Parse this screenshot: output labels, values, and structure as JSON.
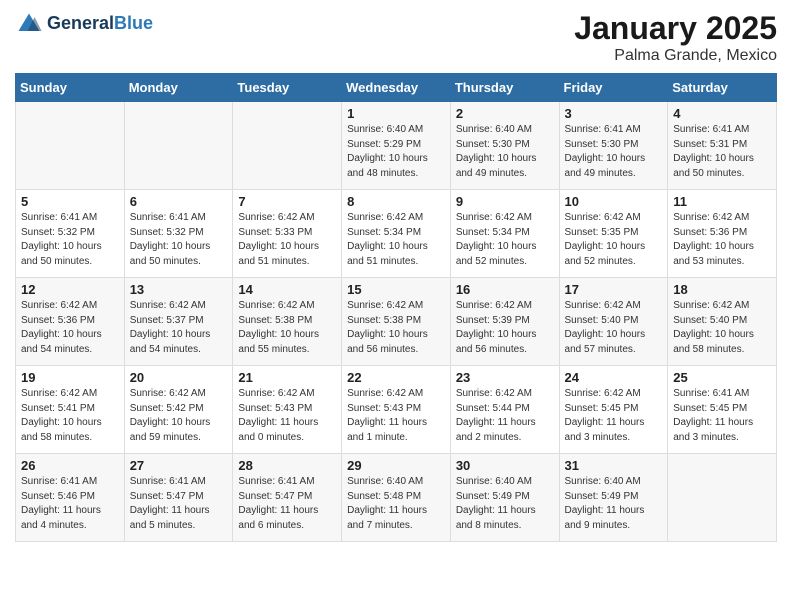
{
  "logo": {
    "line1": "General",
    "line2": "Blue"
  },
  "title": "January 2025",
  "subtitle": "Palma Grande, Mexico",
  "days_of_week": [
    "Sunday",
    "Monday",
    "Tuesday",
    "Wednesday",
    "Thursday",
    "Friday",
    "Saturday"
  ],
  "weeks": [
    [
      {
        "day": "",
        "info": ""
      },
      {
        "day": "",
        "info": ""
      },
      {
        "day": "",
        "info": ""
      },
      {
        "day": "1",
        "info": "Sunrise: 6:40 AM\nSunset: 5:29 PM\nDaylight: 10 hours\nand 48 minutes."
      },
      {
        "day": "2",
        "info": "Sunrise: 6:40 AM\nSunset: 5:30 PM\nDaylight: 10 hours\nand 49 minutes."
      },
      {
        "day": "3",
        "info": "Sunrise: 6:41 AM\nSunset: 5:30 PM\nDaylight: 10 hours\nand 49 minutes."
      },
      {
        "day": "4",
        "info": "Sunrise: 6:41 AM\nSunset: 5:31 PM\nDaylight: 10 hours\nand 50 minutes."
      }
    ],
    [
      {
        "day": "5",
        "info": "Sunrise: 6:41 AM\nSunset: 5:32 PM\nDaylight: 10 hours\nand 50 minutes."
      },
      {
        "day": "6",
        "info": "Sunrise: 6:41 AM\nSunset: 5:32 PM\nDaylight: 10 hours\nand 50 minutes."
      },
      {
        "day": "7",
        "info": "Sunrise: 6:42 AM\nSunset: 5:33 PM\nDaylight: 10 hours\nand 51 minutes."
      },
      {
        "day": "8",
        "info": "Sunrise: 6:42 AM\nSunset: 5:34 PM\nDaylight: 10 hours\nand 51 minutes."
      },
      {
        "day": "9",
        "info": "Sunrise: 6:42 AM\nSunset: 5:34 PM\nDaylight: 10 hours\nand 52 minutes."
      },
      {
        "day": "10",
        "info": "Sunrise: 6:42 AM\nSunset: 5:35 PM\nDaylight: 10 hours\nand 52 minutes."
      },
      {
        "day": "11",
        "info": "Sunrise: 6:42 AM\nSunset: 5:36 PM\nDaylight: 10 hours\nand 53 minutes."
      }
    ],
    [
      {
        "day": "12",
        "info": "Sunrise: 6:42 AM\nSunset: 5:36 PM\nDaylight: 10 hours\nand 54 minutes."
      },
      {
        "day": "13",
        "info": "Sunrise: 6:42 AM\nSunset: 5:37 PM\nDaylight: 10 hours\nand 54 minutes."
      },
      {
        "day": "14",
        "info": "Sunrise: 6:42 AM\nSunset: 5:38 PM\nDaylight: 10 hours\nand 55 minutes."
      },
      {
        "day": "15",
        "info": "Sunrise: 6:42 AM\nSunset: 5:38 PM\nDaylight: 10 hours\nand 56 minutes."
      },
      {
        "day": "16",
        "info": "Sunrise: 6:42 AM\nSunset: 5:39 PM\nDaylight: 10 hours\nand 56 minutes."
      },
      {
        "day": "17",
        "info": "Sunrise: 6:42 AM\nSunset: 5:40 PM\nDaylight: 10 hours\nand 57 minutes."
      },
      {
        "day": "18",
        "info": "Sunrise: 6:42 AM\nSunset: 5:40 PM\nDaylight: 10 hours\nand 58 minutes."
      }
    ],
    [
      {
        "day": "19",
        "info": "Sunrise: 6:42 AM\nSunset: 5:41 PM\nDaylight: 10 hours\nand 58 minutes."
      },
      {
        "day": "20",
        "info": "Sunrise: 6:42 AM\nSunset: 5:42 PM\nDaylight: 10 hours\nand 59 minutes."
      },
      {
        "day": "21",
        "info": "Sunrise: 6:42 AM\nSunset: 5:43 PM\nDaylight: 11 hours\nand 0 minutes."
      },
      {
        "day": "22",
        "info": "Sunrise: 6:42 AM\nSunset: 5:43 PM\nDaylight: 11 hours\nand 1 minute."
      },
      {
        "day": "23",
        "info": "Sunrise: 6:42 AM\nSunset: 5:44 PM\nDaylight: 11 hours\nand 2 minutes."
      },
      {
        "day": "24",
        "info": "Sunrise: 6:42 AM\nSunset: 5:45 PM\nDaylight: 11 hours\nand 3 minutes."
      },
      {
        "day": "25",
        "info": "Sunrise: 6:41 AM\nSunset: 5:45 PM\nDaylight: 11 hours\nand 3 minutes."
      }
    ],
    [
      {
        "day": "26",
        "info": "Sunrise: 6:41 AM\nSunset: 5:46 PM\nDaylight: 11 hours\nand 4 minutes."
      },
      {
        "day": "27",
        "info": "Sunrise: 6:41 AM\nSunset: 5:47 PM\nDaylight: 11 hours\nand 5 minutes."
      },
      {
        "day": "28",
        "info": "Sunrise: 6:41 AM\nSunset: 5:47 PM\nDaylight: 11 hours\nand 6 minutes."
      },
      {
        "day": "29",
        "info": "Sunrise: 6:40 AM\nSunset: 5:48 PM\nDaylight: 11 hours\nand 7 minutes."
      },
      {
        "day": "30",
        "info": "Sunrise: 6:40 AM\nSunset: 5:49 PM\nDaylight: 11 hours\nand 8 minutes."
      },
      {
        "day": "31",
        "info": "Sunrise: 6:40 AM\nSunset: 5:49 PM\nDaylight: 11 hours\nand 9 minutes."
      },
      {
        "day": "",
        "info": ""
      }
    ]
  ]
}
